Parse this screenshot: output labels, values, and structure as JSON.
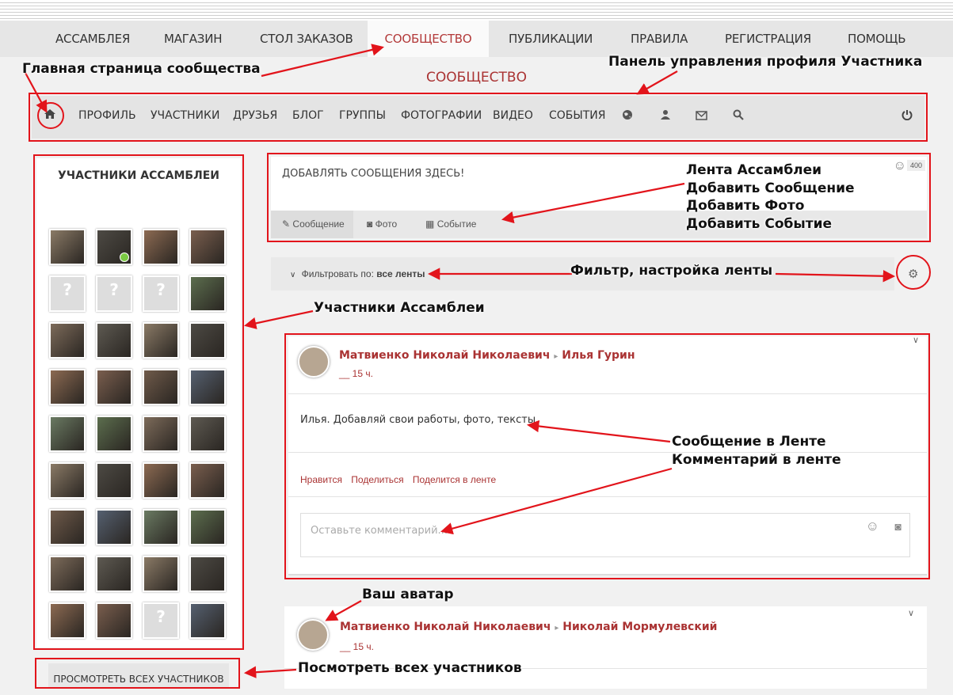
{
  "top_nav": [
    {
      "label": "АССАМБЛЕЯ",
      "active": false
    },
    {
      "label": "МАГАЗИН",
      "active": false
    },
    {
      "label": "СТОЛ ЗАКАЗОВ",
      "active": false
    },
    {
      "label": "СООБЩЕСТВО",
      "active": true
    },
    {
      "label": "ПУБЛИКАЦИИ",
      "active": false
    },
    {
      "label": "ПРАВИЛА",
      "active": false
    },
    {
      "label": "РЕГИСТРАЦИЯ",
      "active": false
    },
    {
      "label": "ПОМОЩЬ",
      "active": false
    }
  ],
  "community_title": "СООБЩЕСТВО",
  "sub_nav": {
    "items": [
      "ПРОФИЛЬ",
      "УЧАСТНИКИ",
      "ДРУЗЬЯ",
      "БЛОГ",
      "ГРУППЫ",
      "ФОТОГРАФИИ",
      "ВИДЕО",
      "СОБЫТИЯ"
    ],
    "icons": [
      "home-icon",
      "globe-icon",
      "person-icon",
      "envelope-icon",
      "search-icon",
      "power-icon"
    ]
  },
  "members_panel": {
    "title": "УЧАСТНИКИ АССАМБЛЕИ",
    "view_all": "ПРОСМОТРЕТЬ ВСЕХ УЧАСТНИКОВ"
  },
  "composer": {
    "placeholder": "ДОБАВЛЯТЬ СООБЩЕНИЯ ЗДЕСЬ!",
    "char_count": "400",
    "tabs": [
      "Сообщение",
      "Фото",
      "Событие"
    ]
  },
  "filter": {
    "prefix": "Фильтровать по:",
    "value": "все ленты"
  },
  "posts": [
    {
      "author": "Матвиенко Николай Николаевич",
      "arrow": "▸",
      "target": "Илья Гурин",
      "time": "__ 15 ч.",
      "text": "Илья. Добавляй свои работы, фото, тексты.",
      "actions": [
        "Нравится",
        "Поделиться",
        "Поделится в ленте"
      ],
      "comment_placeholder": "Оставьте комментарий..."
    },
    {
      "author": "Матвиенко Николай Николаевич",
      "arrow": "▸",
      "target": "Николай Мормулевский",
      "time": "__ 15 ч."
    }
  ],
  "annotations": {
    "main_page": "Главная страница сообщества",
    "profile_panel": "Панель управления профиля Участника",
    "feed_lines": [
      "Лента Ассамблеи",
      "Добавить Сообщение",
      "Добавить Фото",
      "Добавить Событие"
    ],
    "filter": "Фильтр, настройка ленты",
    "members": "Участники Ассамблеи",
    "message": "Сообщение в Ленте",
    "comment": "Комментарий в ленте",
    "avatar": "Ваш аватар",
    "view_all": "Посмотреть всех участников"
  },
  "colors": {
    "accent": "#b33a3a",
    "callout": "#e2141b"
  }
}
